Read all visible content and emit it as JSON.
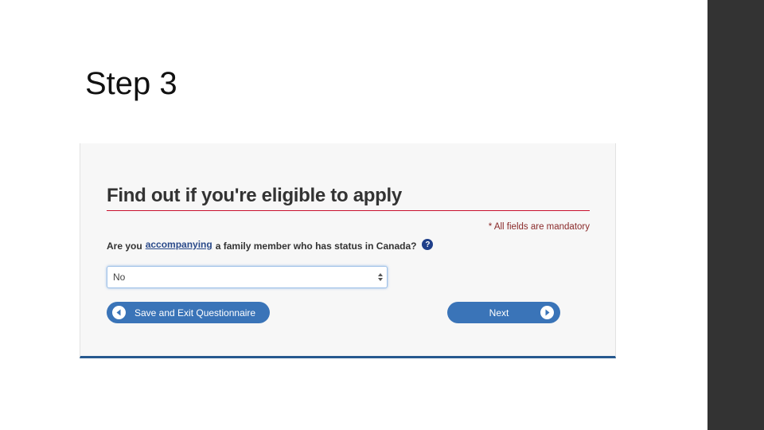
{
  "slide": {
    "title": "Step 3"
  },
  "form": {
    "heading": "Find out if you're eligible to apply",
    "mandatory_note": "* All fields are mandatory",
    "question": {
      "prefix": "Are you",
      "link_text": "accompanying",
      "suffix": "a family member who has status in Canada?",
      "help_icon": "question-icon"
    },
    "select": {
      "value": "No"
    },
    "buttons": {
      "save_exit_label": "Save and Exit Questionnaire",
      "next_label": "Next"
    }
  },
  "colors": {
    "accent_blue": "#3a74b8",
    "rule_red": "#c8102e",
    "bottom_border": "#26598f",
    "sidebar": "#333333"
  }
}
